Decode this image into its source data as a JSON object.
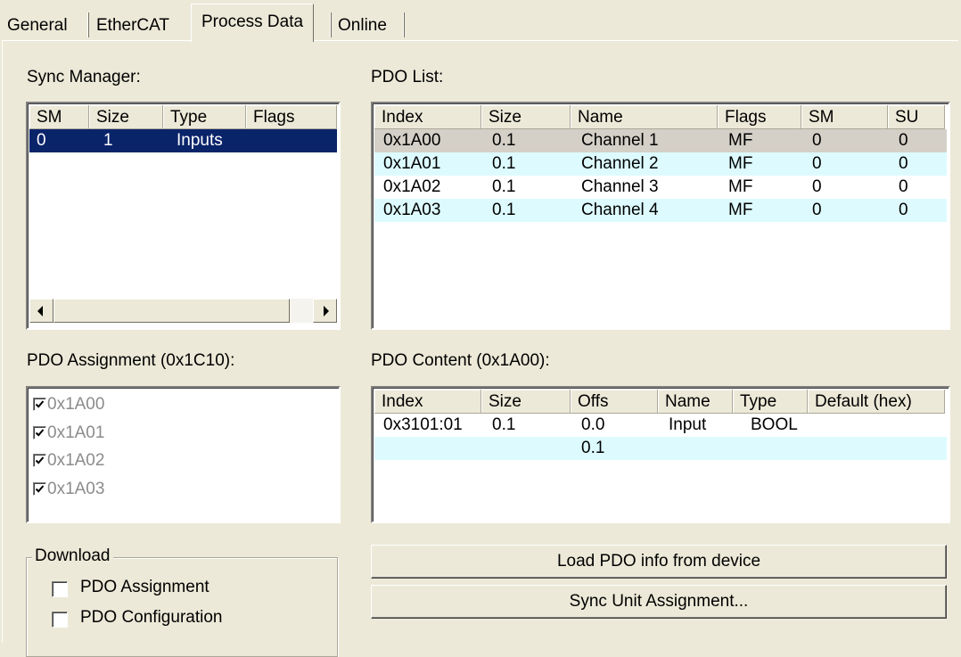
{
  "tabs": [
    {
      "label": "General"
    },
    {
      "label": "EtherCAT"
    },
    {
      "label": "Process Data",
      "selected": true
    },
    {
      "label": "Online"
    }
  ],
  "sync_manager": {
    "label": "Sync Manager:",
    "columns": [
      "SM",
      "Size",
      "Type",
      "Flags"
    ],
    "rows": [
      {
        "sm": "0",
        "size": "1",
        "type": "Inputs",
        "flags": ""
      }
    ]
  },
  "pdo_list": {
    "label": "PDO List:",
    "columns": [
      "Index",
      "Size",
      "Name",
      "Flags",
      "SM",
      "SU"
    ],
    "rows": [
      {
        "index": "0x1A00",
        "size": "0.1",
        "name": "Channel 1",
        "flags": "MF",
        "sm": "0",
        "su": "0"
      },
      {
        "index": "0x1A01",
        "size": "0.1",
        "name": "Channel 2",
        "flags": "MF",
        "sm": "0",
        "su": "0"
      },
      {
        "index": "0x1A02",
        "size": "0.1",
        "name": "Channel 3",
        "flags": "MF",
        "sm": "0",
        "su": "0"
      },
      {
        "index": "0x1A03",
        "size": "0.1",
        "name": "Channel 4",
        "flags": "MF",
        "sm": "0",
        "su": "0"
      }
    ]
  },
  "pdo_assignment": {
    "label": "PDO Assignment (0x1C10):",
    "items": [
      {
        "label": "0x1A00",
        "checked": true
      },
      {
        "label": "0x1A01",
        "checked": true
      },
      {
        "label": "0x1A02",
        "checked": true
      },
      {
        "label": "0x1A03",
        "checked": true
      }
    ]
  },
  "pdo_content": {
    "label": "PDO Content (0x1A00):",
    "columns": [
      "Index",
      "Size",
      "Offs",
      "Name",
      "Type",
      "Default (hex)"
    ],
    "rows": [
      {
        "index": "0x3101:01",
        "size": "0.1",
        "offs": "0.0",
        "name": "Input",
        "type": "BOOL",
        "default": ""
      },
      {
        "index": "",
        "size": "",
        "offs": "0.1",
        "name": "",
        "type": "",
        "default": ""
      }
    ]
  },
  "download": {
    "title": "Download",
    "options": [
      {
        "label": "PDO Assignment",
        "checked": false
      },
      {
        "label": "PDO Configuration",
        "checked": false
      }
    ]
  },
  "buttons": {
    "load_pdo": "Load PDO info from device",
    "sync_unit": "Sync Unit Assignment..."
  },
  "colors": {
    "dialog_bg": "#ECE9D8",
    "selection": "#0A246A",
    "alt_row": "#DDFBFF"
  }
}
